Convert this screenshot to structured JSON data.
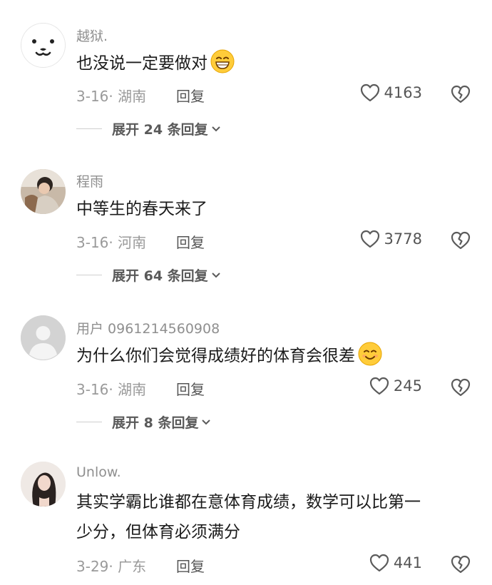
{
  "comments": [
    {
      "username": "越狱.",
      "text": "也没说一定要做对",
      "date_location": "3-16· 湖南",
      "reply_label": "回复",
      "likes": "4163",
      "expand_label": "展开 24 条回复",
      "avatar": "white-dog-face-icon",
      "emoji": "grinning-face-icon"
    },
    {
      "username": "程雨",
      "text": "中等生的春天来了",
      "date_location": "3-16· 河南",
      "reply_label": "回复",
      "likes": "3778",
      "expand_label": "展开 64 条回复",
      "avatar": "photo-avatar"
    },
    {
      "username": "用户 0961214560908",
      "text": "为什么你们会觉得成绩好的体育会很差",
      "date_location": "3-16· 湖南",
      "reply_label": "回复",
      "likes": "245",
      "expand_label": "展开 8 条回复",
      "avatar": "default-user-icon",
      "emoji": "smiling-face-icon"
    },
    {
      "username": "Unlow.",
      "text_line1": "其实学霸比谁都在意体育成绩，数学可以比第一",
      "text_line2": "少分，但体育必须满分",
      "date_location": "3-29· 广东",
      "reply_label": "回复",
      "likes": "441",
      "avatar": "photo-avatar-portrait"
    }
  ],
  "colors": {
    "background": "#ffffff",
    "text_primary": "#1b1b1b",
    "text_secondary": "#9a9a9a",
    "icon_stroke": "#5b5b5b"
  }
}
